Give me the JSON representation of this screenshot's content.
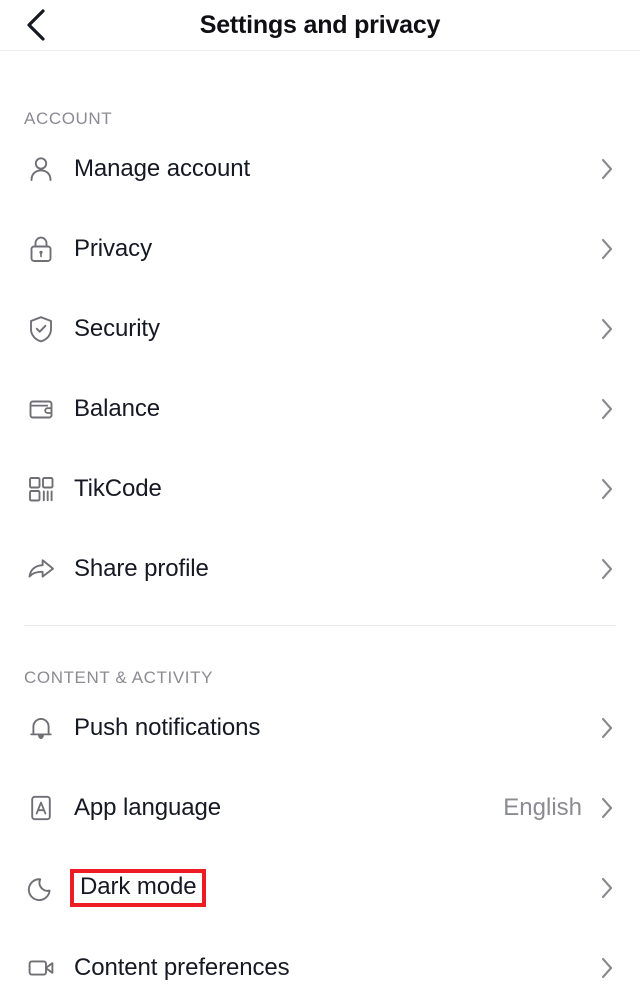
{
  "header": {
    "title": "Settings and privacy",
    "back_icon": "chevron-left-icon"
  },
  "sections": [
    {
      "id": "account",
      "label": "ACCOUNT",
      "items": [
        {
          "label": "Manage account",
          "icon": "person-icon",
          "value": "",
          "chevron": "chevron-right-icon"
        },
        {
          "label": "Privacy",
          "icon": "lock-icon",
          "value": "",
          "chevron": "chevron-right-icon"
        },
        {
          "label": "Security",
          "icon": "shield-check-icon",
          "value": "",
          "chevron": "chevron-right-icon"
        },
        {
          "label": "Balance",
          "icon": "wallet-icon",
          "value": "",
          "chevron": "chevron-right-icon"
        },
        {
          "label": "TikCode",
          "icon": "qr-code-icon",
          "value": "",
          "chevron": "chevron-right-icon"
        },
        {
          "label": "Share profile",
          "icon": "share-arrow-icon",
          "value": "",
          "chevron": "chevron-right-icon"
        }
      ]
    },
    {
      "id": "content",
      "label": "CONTENT & ACTIVITY",
      "items": [
        {
          "label": "Push notifications",
          "icon": "bell-icon",
          "value": "",
          "chevron": "chevron-right-icon"
        },
        {
          "label": "App language",
          "icon": "letter-a-box-icon",
          "value": "English",
          "chevron": "chevron-right-icon"
        },
        {
          "label": "Dark mode",
          "icon": "moon-icon",
          "value": "",
          "chevron": "chevron-right-icon",
          "annotated": true
        },
        {
          "label": "Content preferences",
          "icon": "video-camera-icon",
          "value": "",
          "chevron": "chevron-right-icon"
        }
      ]
    }
  ],
  "colors": {
    "annotation": "#ec1c24",
    "icon": "#6f6f76",
    "text": "#161823",
    "muted": "#8b8b93",
    "divider": "#e9e9ea",
    "background": "#ffffff"
  }
}
